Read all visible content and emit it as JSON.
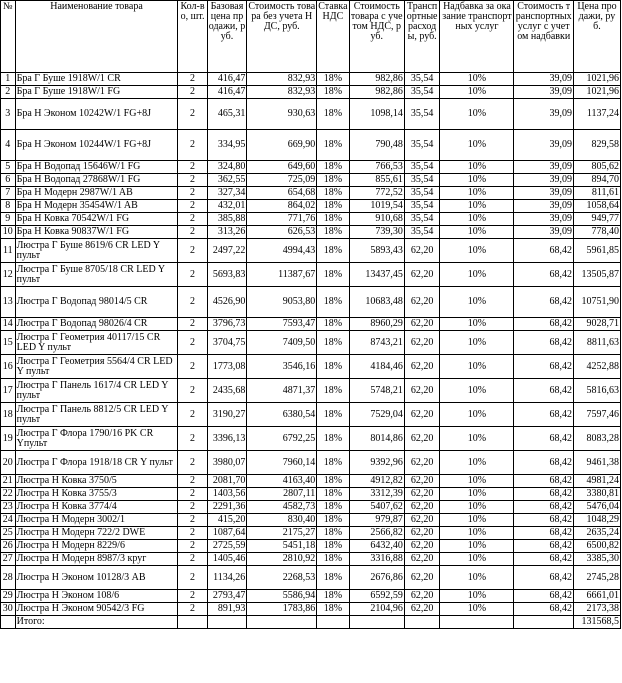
{
  "headers": {
    "num": "№",
    "name": "Наименование товара",
    "qty": "Кол-во, шт.",
    "base": "Базовая цена продажи, руб.",
    "cost_no_vat": "Стоимость товара без учета НДС, руб.",
    "vat_rate": "Ставка НДС",
    "cost_vat": "Стоимость товара с учетом НДС, руб.",
    "transport": "Транспортные расходы, руб.",
    "markup": "Надбавка за оказание транспортных услуг",
    "transport_total": "Стоимость транспортных услуг с учетом надбавки",
    "price": "Цена продажи, руб."
  },
  "rows": [
    {
      "num": "1",
      "name": "Бра Г Буше 1918W/1 CR",
      "qty": "2",
      "base": "416,47",
      "cost_no_vat": "832,93",
      "vat": "18%",
      "cost_vat": "982,86",
      "transport": "35,54",
      "markup": "10%",
      "transport_total": "39,09",
      "price": "1021,96",
      "h": "h1"
    },
    {
      "num": "2",
      "name": "Бра Г Буше 1918W/1 FG",
      "qty": "2",
      "base": "416,47",
      "cost_no_vat": "832,93",
      "vat": "18%",
      "cost_vat": "982,86",
      "transport": "35,54",
      "markup": "10%",
      "transport_total": "39,09",
      "price": "1021,96",
      "h": "h1"
    },
    {
      "num": "3",
      "name": "Бра Н Эконом 10242W/1 FG+8J",
      "qty": "2",
      "base": "465,31",
      "cost_no_vat": "930,63",
      "vat": "18%",
      "cost_vat": "1098,14",
      "transport": "35,54",
      "markup": "10%",
      "transport_total": "39,09",
      "price": "1137,24",
      "h": "h3"
    },
    {
      "num": "4",
      "name": "Бра Н Эконом 10244W/1 FG+8J",
      "qty": "2",
      "base": "334,95",
      "cost_no_vat": "669,90",
      "vat": "18%",
      "cost_vat": "790,48",
      "transport": "35,54",
      "markup": "10%",
      "transport_total": "39,09",
      "price": "829,58",
      "h": "h3"
    },
    {
      "num": "5",
      "name": "Бра Н Водопад 15646W/1 FG",
      "qty": "2",
      "base": "324,80",
      "cost_no_vat": "649,60",
      "vat": "18%",
      "cost_vat": "766,53",
      "transport": "35,54",
      "markup": "10%",
      "transport_total": "39,09",
      "price": "805,62",
      "h": "h1"
    },
    {
      "num": "6",
      "name": "Бра Н Водопад 27868W/1 FG",
      "qty": "2",
      "base": "362,55",
      "cost_no_vat": "725,09",
      "vat": "18%",
      "cost_vat": "855,61",
      "transport": "35,54",
      "markup": "10%",
      "transport_total": "39,09",
      "price": "894,70",
      "h": "h1"
    },
    {
      "num": "7",
      "name": "Бра Н Модерн 2987W/1 AB",
      "qty": "2",
      "base": "327,34",
      "cost_no_vat": "654,68",
      "vat": "18%",
      "cost_vat": "772,52",
      "transport": "35,54",
      "markup": "10%",
      "transport_total": "39,09",
      "price": "811,61",
      "h": "h1"
    },
    {
      "num": "8",
      "name": "Бра Н Модерн 35454W/1 AB",
      "qty": "2",
      "base": "432,01",
      "cost_no_vat": "864,02",
      "vat": "18%",
      "cost_vat": "1019,54",
      "transport": "35,54",
      "markup": "10%",
      "transport_total": "39,09",
      "price": "1058,64",
      "h": "h1"
    },
    {
      "num": "9",
      "name": "Бра Н Ковка 70542W/1 FG",
      "qty": "2",
      "base": "385,88",
      "cost_no_vat": "771,76",
      "vat": "18%",
      "cost_vat": "910,68",
      "transport": "35,54",
      "markup": "10%",
      "transport_total": "39,09",
      "price": "949,77",
      "h": "h1"
    },
    {
      "num": "10",
      "name": "Бра Н Ковка 90837W/1 FG",
      "qty": "2",
      "base": "313,26",
      "cost_no_vat": "626,53",
      "vat": "18%",
      "cost_vat": "739,30",
      "transport": "35,54",
      "markup": "10%",
      "transport_total": "39,09",
      "price": "778,40",
      "h": "h1"
    },
    {
      "num": "11",
      "name": "Люстра Г Буше 8619/6 CR LED Y пульт",
      "qty": "2",
      "base": "2497,22",
      "cost_no_vat": "4994,43",
      "vat": "18%",
      "cost_vat": "5893,43",
      "transport": "62,20",
      "markup": "10%",
      "transport_total": "68,42",
      "price": "5961,85",
      "h": "h2"
    },
    {
      "num": "12",
      "name": "Люстра Г Буше 8705/18 CR LED Y пульт",
      "qty": "2",
      "base": "5693,83",
      "cost_no_vat": "11387,67",
      "vat": "18%",
      "cost_vat": "13437,45",
      "transport": "62,20",
      "markup": "10%",
      "transport_total": "68,42",
      "price": "13505,87",
      "h": "h2"
    },
    {
      "num": "13",
      "name": "Люстра Г Водопад 98014/5 CR",
      "qty": "2",
      "base": "4526,90",
      "cost_no_vat": "9053,80",
      "vat": "18%",
      "cost_vat": "10683,48",
      "transport": "62,20",
      "markup": "10%",
      "transport_total": "68,42",
      "price": "10751,90",
      "h": "h3"
    },
    {
      "num": "14",
      "name": "Люстра Г Водопад 98026/4 CR",
      "qty": "2",
      "base": "3796,73",
      "cost_no_vat": "7593,47",
      "vat": "18%",
      "cost_vat": "8960,29",
      "transport": "62,20",
      "markup": "10%",
      "transport_total": "68,42",
      "price": "9028,71",
      "h": "h1"
    },
    {
      "num": "15",
      "name": "Люстра Г Геометрия 40117/15 CR LED Y пульт",
      "qty": "2",
      "base": "3704,75",
      "cost_no_vat": "7409,50",
      "vat": "18%",
      "cost_vat": "8743,21",
      "transport": "62,20",
      "markup": "10%",
      "transport_total": "68,42",
      "price": "8811,63",
      "h": "h2"
    },
    {
      "num": "16",
      "name": "Люстра Г Геометрия 5564/4 CR LED Y пульт",
      "qty": "2",
      "base": "1773,08",
      "cost_no_vat": "3546,16",
      "vat": "18%",
      "cost_vat": "4184,46",
      "transport": "62,20",
      "markup": "10%",
      "transport_total": "68,42",
      "price": "4252,88",
      "h": "h2"
    },
    {
      "num": "17",
      "name": "Люстра Г Панель 1617/4 CR LED Y пульт",
      "qty": "2",
      "base": "2435,68",
      "cost_no_vat": "4871,37",
      "vat": "18%",
      "cost_vat": "5748,21",
      "transport": "62,20",
      "markup": "10%",
      "transport_total": "68,42",
      "price": "5816,63",
      "h": "h2"
    },
    {
      "num": "18",
      "name": "Люстра Г Панель 8812/5 CR LED Y пульт",
      "qty": "2",
      "base": "3190,27",
      "cost_no_vat": "6380,54",
      "vat": "18%",
      "cost_vat": "7529,04",
      "transport": "62,20",
      "markup": "10%",
      "transport_total": "68,42",
      "price": "7597,46",
      "h": "h2"
    },
    {
      "num": "19",
      "name": "Люстра Г Флора 1790/16 PK CR Yпульт",
      "qty": "2",
      "base": "3396,13",
      "cost_no_vat": "6792,25",
      "vat": "18%",
      "cost_vat": "8014,86",
      "transport": "62,20",
      "markup": "10%",
      "transport_total": "68,42",
      "price": "8083,28",
      "h": "h2"
    },
    {
      "num": "20",
      "name": "Люстра Г Флора 1918/18 CR Y пульт",
      "qty": "2",
      "base": "3980,07",
      "cost_no_vat": "7960,14",
      "vat": "18%",
      "cost_vat": "9392,96",
      "transport": "62,20",
      "markup": "10%",
      "transport_total": "68,42",
      "price": "9461,38",
      "h": "h2"
    },
    {
      "num": "21",
      "name": "Люстра Н Ковка 3750/5",
      "qty": "2",
      "base": "2081,70",
      "cost_no_vat": "4163,40",
      "vat": "18%",
      "cost_vat": "4912,82",
      "transport": "62,20",
      "markup": "10%",
      "transport_total": "68,42",
      "price": "4981,24",
      "h": "h1"
    },
    {
      "num": "22",
      "name": "Люстра Н Ковка 3755/3",
      "qty": "2",
      "base": "1403,56",
      "cost_no_vat": "2807,11",
      "vat": "18%",
      "cost_vat": "3312,39",
      "transport": "62,20",
      "markup": "10%",
      "transport_total": "68,42",
      "price": "3380,81",
      "h": "h1"
    },
    {
      "num": "23",
      "name": "Люстра Н Ковка 3774/4",
      "qty": "2",
      "base": "2291,36",
      "cost_no_vat": "4582,73",
      "vat": "18%",
      "cost_vat": "5407,62",
      "transport": "62,20",
      "markup": "10%",
      "transport_total": "68,42",
      "price": "5476,04",
      "h": "h1"
    },
    {
      "num": "24",
      "name": "Люстра Н Модерн 3002/1",
      "qty": "2",
      "base": "415,20",
      "cost_no_vat": "830,40",
      "vat": "18%",
      "cost_vat": "979,87",
      "transport": "62,20",
      "markup": "10%",
      "transport_total": "68,42",
      "price": "1048,29",
      "h": "h1"
    },
    {
      "num": "25",
      "name": "Люстра Н Модерн 722/2 DWE",
      "qty": "2",
      "base": "1087,64",
      "cost_no_vat": "2175,27",
      "vat": "18%",
      "cost_vat": "2566,82",
      "transport": "62,20",
      "markup": "10%",
      "transport_total": "68,42",
      "price": "2635,24",
      "h": "h1"
    },
    {
      "num": "26",
      "name": "Люстра Н Модерн 8229/6",
      "qty": "2",
      "base": "2725,59",
      "cost_no_vat": "5451,18",
      "vat": "18%",
      "cost_vat": "6432,40",
      "transport": "62,20",
      "markup": "10%",
      "transport_total": "68,42",
      "price": "6500,82",
      "h": "h1"
    },
    {
      "num": "27",
      "name": "Люстра Н Модерн 8987/3 круг",
      "qty": "2",
      "base": "1405,46",
      "cost_no_vat": "2810,92",
      "vat": "18%",
      "cost_vat": "3316,88",
      "transport": "62,20",
      "markup": "10%",
      "transport_total": "68,42",
      "price": "3385,30",
      "h": "h1"
    },
    {
      "num": "28",
      "name": "Люстра Н Эконом 10128/3 AB",
      "qty": "2",
      "base": "1134,26",
      "cost_no_vat": "2268,53",
      "vat": "18%",
      "cost_vat": "2676,86",
      "transport": "62,20",
      "markup": "10%",
      "transport_total": "68,42",
      "price": "2745,28",
      "h": "h2"
    },
    {
      "num": "29",
      "name": "Люстра Н Эконом 108/6",
      "qty": "2",
      "base": "2793,47",
      "cost_no_vat": "5586,94",
      "vat": "18%",
      "cost_vat": "6592,59",
      "transport": "62,20",
      "markup": "10%",
      "transport_total": "68,42",
      "price": "6661,01",
      "h": "h1"
    },
    {
      "num": "30",
      "name": "Люстра Н Эконом 90542/3 FG",
      "qty": "2",
      "base": "891,93",
      "cost_no_vat": "1783,86",
      "vat": "18%",
      "cost_vat": "2104,96",
      "transport": "62,20",
      "markup": "10%",
      "transport_total": "68,42",
      "price": "2173,38",
      "h": "h1"
    }
  ],
  "total": {
    "label": "Итого:",
    "value": "131568,5"
  }
}
